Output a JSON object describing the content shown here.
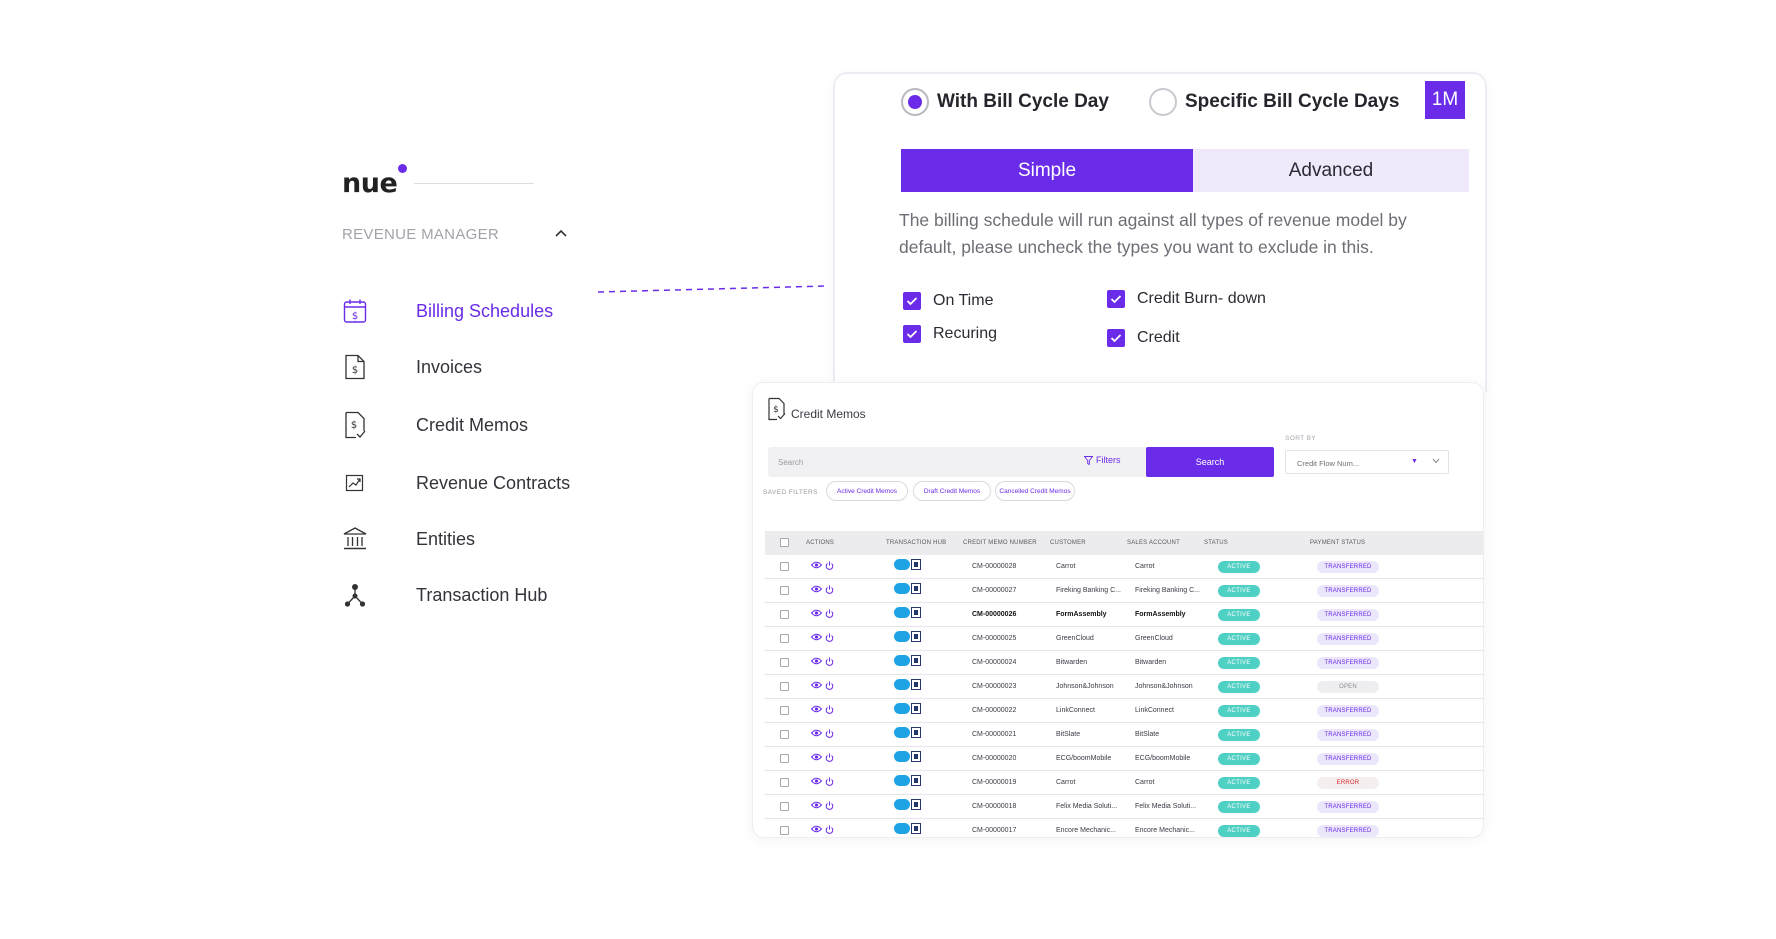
{
  "sidebar": {
    "logo": "nue",
    "section_title": "REVENUE MANAGER",
    "items": [
      {
        "label": "Billing Schedules",
        "icon": "calendar-dollar-icon",
        "active": true
      },
      {
        "label": "Invoices",
        "icon": "invoice-dollar-icon",
        "active": false
      },
      {
        "label": "Credit Memos",
        "icon": "credit-memo-icon",
        "active": false
      },
      {
        "label": "Revenue Contracts",
        "icon": "trend-chart-icon",
        "active": false
      },
      {
        "label": "Entities",
        "icon": "bank-icon",
        "active": false
      },
      {
        "label": "Transaction Hub",
        "icon": "network-hub-icon",
        "active": false
      }
    ]
  },
  "bill_cycle": {
    "option_1": "With Bill Cycle Day",
    "option_2": "Specific Bill Cycle Days",
    "selected": "With Bill Cycle Day",
    "period_tag": "1M",
    "tab_simple": "Simple",
    "tab_advanced": "Advanced",
    "active_tab": "Simple",
    "description": "The billing schedule will run against all types of revenue model by default, please uncheck the types you want to exclude in this.",
    "checkboxes": [
      {
        "label": "On Time",
        "checked": true
      },
      {
        "label": "Recuring",
        "checked": true
      },
      {
        "label": "Credit Burn- down",
        "checked": true
      },
      {
        "label": "Credit",
        "checked": true
      }
    ]
  },
  "credit_memos": {
    "title": "Credit Memos",
    "search_placeholder": "Search",
    "filters_label": "Filters",
    "search_button": "Search",
    "sort_by_label": "SORT BY",
    "sort_value": "Credit Flow Num...",
    "saved_filters_label": "SAVED FILTERS",
    "saved_filters": [
      "Active Credit Memos",
      "Draft Credit Memos",
      "Cancelled Credit Memos"
    ],
    "columns": [
      "ACTIONS",
      "TRANSACTION HUB",
      "CREDIT MEMO NUMBER",
      "CUSTOMER",
      "SALES ACCOUNT",
      "STATUS",
      "PAYMENT STATUS"
    ],
    "rows": [
      {
        "number": "CM-00000028",
        "customer": "Carrot",
        "account": "Carrot",
        "status": "ACTIVE",
        "payment": "TRANSFERRED"
      },
      {
        "number": "CM-00000027",
        "customer": "Fireking Banking C...",
        "account": "Fireking Banking C...",
        "status": "ACTIVE",
        "payment": "TRANSFERRED"
      },
      {
        "number": "CM-00000026",
        "customer": "FormAssembly",
        "account": "FormAssembly",
        "status": "ACTIVE",
        "payment": "TRANSFERRED",
        "bold": true
      },
      {
        "number": "CM-00000025",
        "customer": "GreenCloud",
        "account": "GreenCloud",
        "status": "ACTIVE",
        "payment": "TRANSFERRED"
      },
      {
        "number": "CM-00000024",
        "customer": "Bitwarden",
        "account": "Bitwarden",
        "status": "ACTIVE",
        "payment": "TRANSFERRED"
      },
      {
        "number": "CM-00000023",
        "customer": "Johnson&Johnson",
        "account": "Johnson&Johnson",
        "status": "ACTIVE",
        "payment": "OPEN"
      },
      {
        "number": "CM-00000022",
        "customer": "LinkConnect",
        "account": "LinkConnect",
        "status": "ACTIVE",
        "payment": "TRANSFERRED"
      },
      {
        "number": "CM-00000021",
        "customer": "BitSlate",
        "account": "BitSlate",
        "status": "ACTIVE",
        "payment": "TRANSFERRED"
      },
      {
        "number": "CM-00000020",
        "customer": "ECG/boomMobile",
        "account": "ECG/boomMobile",
        "status": "ACTIVE",
        "payment": "TRANSFERRED"
      },
      {
        "number": "CM-00000019",
        "customer": "Carrot",
        "account": "Carrot",
        "status": "ACTIVE",
        "payment": "ERROR"
      },
      {
        "number": "CM-00000018",
        "customer": "Felix Media Soluti...",
        "account": "Felix Media Soluti...",
        "status": "ACTIVE",
        "payment": "TRANSFERRED"
      },
      {
        "number": "CM-00000017",
        "customer": "Encore Mechanic...",
        "account": "Encore Mechanic...",
        "status": "ACTIVE",
        "payment": "TRANSFERRED"
      }
    ]
  },
  "colors": {
    "accent": "#6a2ce8",
    "status_active": "#4fd0c4",
    "error": "#d62a2a"
  }
}
